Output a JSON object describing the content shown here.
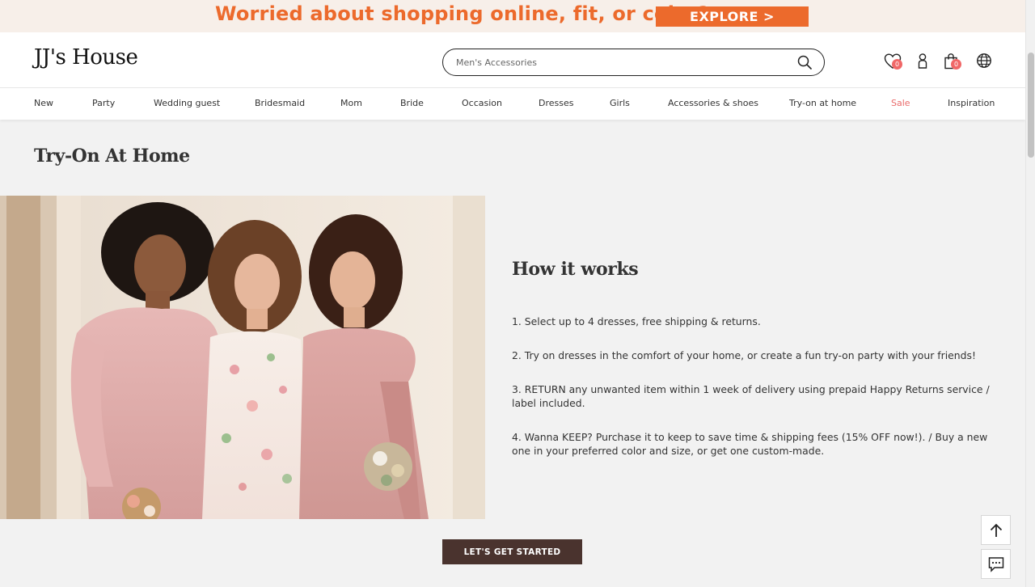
{
  "promo": {
    "text": "Worried about shopping online, fit, or color?",
    "button": "EXPLORE >"
  },
  "header": {
    "logo": "JJ's House",
    "search_placeholder": "Men's Accessories",
    "wishlist_count": "0",
    "cart_count": "0"
  },
  "nav": {
    "items": [
      "New",
      "Party",
      "Wedding guest",
      "Bridesmaid",
      "Mom",
      "Bride",
      "Occasion",
      "Dresses",
      "Girls",
      "Accessories & shoes",
      "Try-on at home",
      "Sale",
      "Inspiration"
    ]
  },
  "main": {
    "title": "Try-On At Home",
    "how_title": "How it works",
    "steps": [
      "1. Select up to 4 dresses, free shipping & returns.",
      "2. Try on dresses in the comfort of your home, or create a fun try-on party with your friends!",
      "3. RETURN any unwanted item within 1 week of delivery using prepaid Happy Returns service / label included.",
      "4. Wanna KEEP? Purchase it to keep to save time & shipping fees (15% OFF now!). / Buy a new one in your preferred color and size, or get one custom-made."
    ],
    "cta": "LET'S GET STARTED"
  },
  "colors": {
    "accent": "#ec6a2c",
    "sale": "#e96b6b",
    "cta_bg": "#4a332e",
    "badge": "#f06767"
  },
  "icons": {
    "search": "search-icon",
    "wishlist": "heart-icon",
    "account": "user-icon",
    "cart": "shopping-bag-icon",
    "language": "globe-icon",
    "back_to_top": "arrow-up-icon",
    "chat": "chat-icon"
  }
}
